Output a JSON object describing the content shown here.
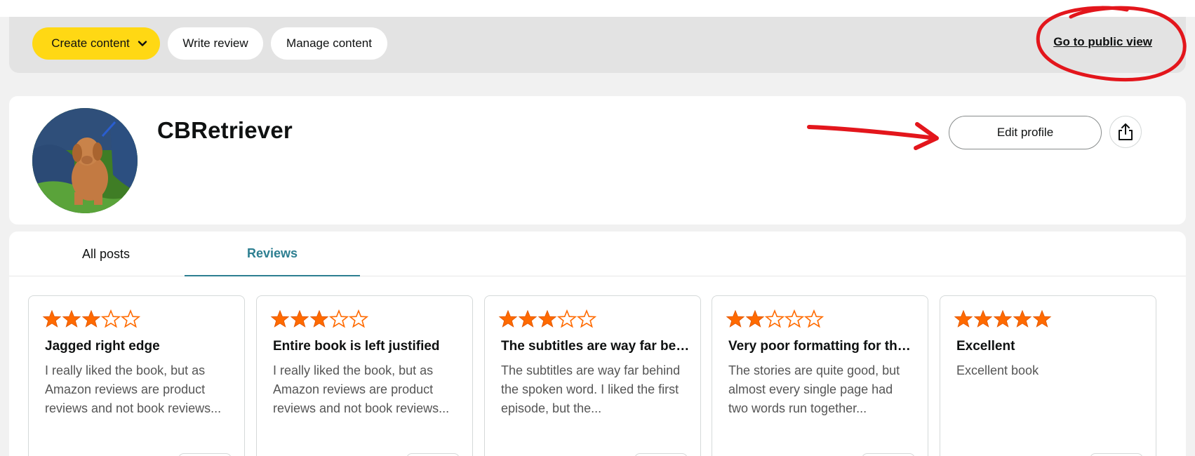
{
  "toolbar": {
    "create_content_label": "Create content",
    "write_review_label": "Write review",
    "manage_content_label": "Manage content",
    "public_view_label": "Go to public view"
  },
  "profile": {
    "username": "CBRetriever",
    "edit_profile_label": "Edit profile"
  },
  "tabs": [
    {
      "label": "All posts",
      "active": false
    },
    {
      "label": "Reviews",
      "active": true
    }
  ],
  "reviews": [
    {
      "rating": 3,
      "title": "Jagged right edge",
      "body": "I really liked the book, but as Amazon reviews are product reviews and not book reviews...",
      "thumb_color": "#1b1b1b"
    },
    {
      "rating": 3,
      "title": "Entire book is left justified",
      "body": "I really liked the book, but as Amazon reviews are product reviews and not book reviews...",
      "thumb_color": "#1b1b1b"
    },
    {
      "rating": 3,
      "title": "The subtitles are way far behind the spoken word",
      "body": "The subtitles are way far behind the spoken word. I liked the first episode, but the...",
      "thumb_color": "#ffffff"
    },
    {
      "rating": 2,
      "title": "Very poor formatting for the stories",
      "body": "The stories are quite good, but almost every single page had two words run together...",
      "thumb_color": "#b05a5a"
    },
    {
      "rating": 5,
      "title": "Excellent",
      "body": "Excellent book",
      "thumb_color": "#0c1a2e"
    }
  ],
  "colors": {
    "accent_yellow": "#ffd814",
    "star_orange": "#ff6a00",
    "tab_active": "#2d7f91",
    "annotation_red": "#e3161c"
  },
  "icons": {
    "dropdown": "chevron-down-icon",
    "share": "share-icon",
    "star": "star-icon"
  }
}
